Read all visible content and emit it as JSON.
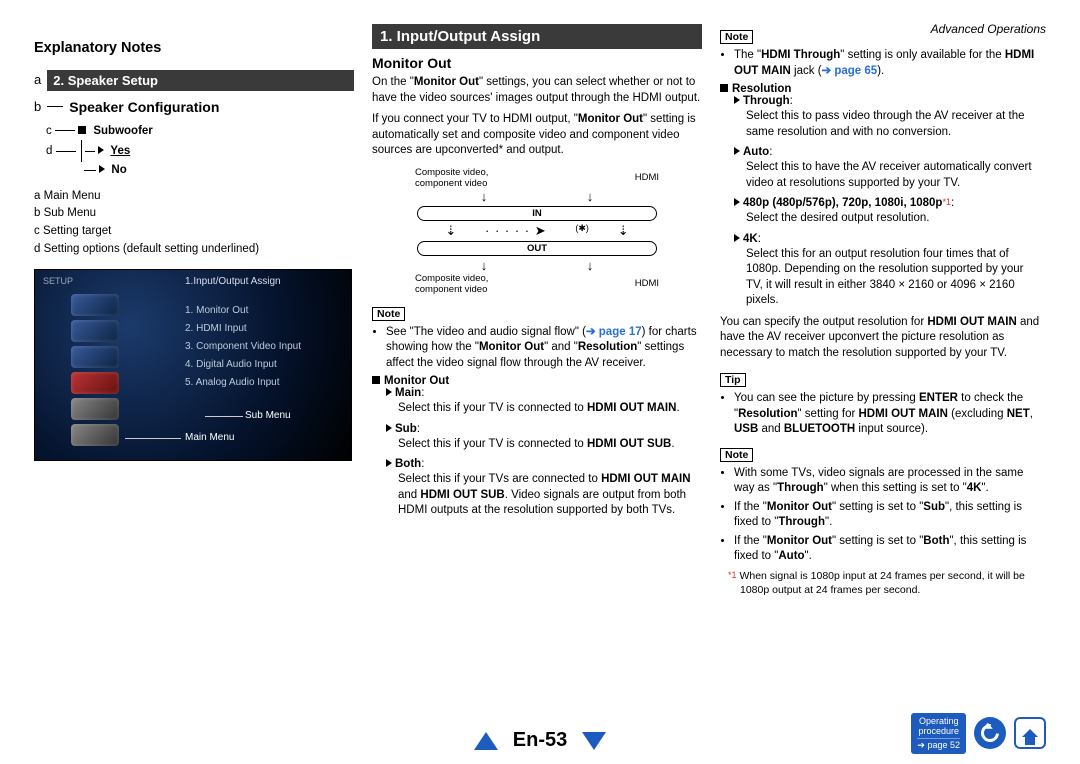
{
  "header": {
    "right": "Advanced Operations"
  },
  "col1": {
    "h": "Explanatory Notes",
    "bar": "2. Speaker Setup",
    "sub": "Speaker Configuration",
    "subwoofer_lbl": "Subwoofer",
    "yes": "Yes",
    "no": "No",
    "markers": {
      "m1": "a",
      "m2": "b",
      "m3": "c",
      "m4": "d"
    },
    "legend": {
      "l1": "Main Menu",
      "l2": "Sub Menu",
      "l3": "Setting target",
      "l4": "Setting options (default setting underlined)"
    },
    "shot": {
      "setup": "SETUP",
      "title": "1.Input/Output Assign",
      "items": [
        "1. Monitor Out",
        "2. HDMI Input",
        "3. Component Video Input",
        "4. Digital Audio Input",
        "5. Analog Audio Input"
      ],
      "ptr_sub": "Sub Menu",
      "ptr_main": "Main Menu"
    }
  },
  "col2": {
    "secTitle": "1. Input/Output Assign",
    "secSub": "Monitor Out",
    "p1a": "On the \"",
    "p1b": "Monitor Out",
    "p1c": "\" settings, you can select whether or not to have the video sources' images output through the HDMI output.",
    "p2a": "If you connect your TV to HDMI output, \"",
    "p2b": "Monitor Out",
    "p2c": "\" setting is automatically set and composite video and component video sources are upconverted* and output.",
    "sig": {
      "top_l": "Composite video,\ncomponent video",
      "top_r": "HDMI",
      "in": "IN",
      "out": "OUT",
      "star": "(✱)",
      "bot_l": "Composite video,\ncomponent video",
      "bot_r": "HDMI"
    },
    "noteLbl": "Note",
    "note1a": "See \"The video and audio signal flow\" (",
    "note1link": "➔ page 17",
    "note1b": ") for charts showing how the \"",
    "note1c": "Monitor Out",
    "note1d": "\" and \"",
    "note1e": "Resolution",
    "note1f": "\" settings affect the video signal flow through the AV receiver.",
    "mo_h": "Monitor Out",
    "main_h": "Main",
    "main_p": "Select this if your TV is connected to ",
    "main_b": "HDMI OUT MAIN",
    "sub_h": "Sub",
    "sub_p": "Select this if your TV is connected to ",
    "sub_b": "HDMI OUT SUB",
    "both_h": "Both",
    "both_p1": "Select this if your TVs are connected to ",
    "both_b1": "HDMI OUT MAIN",
    "both_mid": " and ",
    "both_b2": "HDMI OUT SUB",
    "both_p2": ". Video signals are output from both HDMI outputs at the resolution supported by both TVs."
  },
  "col3": {
    "noteLbl": "Note",
    "n1a": "The \"",
    "n1b": "HDMI Through",
    "n1c": "\" setting is only available for the ",
    "n1d": "HDMI OUT MAIN",
    "n1e": " jack (",
    "n1link": "➔ page 65",
    "n1f": ").",
    "res_h": "Resolution",
    "thr_h": "Through",
    "thr_p": "Select this to pass video through the AV receiver at the same resolution and with no conversion.",
    "auto_h": "Auto",
    "auto_p": "Select this to have the AV receiver automatically convert video at resolutions supported by your TV.",
    "reslist": "480p (480p/576p), 720p, 1080i, 1080p",
    "reslist_after": ":",
    "res_p": "Select the desired output resolution.",
    "k4_h": "4K",
    "k4_p": "Select this for an output resolution four times that of 1080p. Depending on the resolution supported by your TV, it will result in either 3840 × 2160 or 4096 × 2160 pixels.",
    "spec_p1": "You can specify the output resolution for ",
    "spec_b": "HDMI OUT MAIN",
    "spec_p2": " and have the AV receiver upconvert the picture resolution as necessary to match the resolution supported by your TV.",
    "tipLbl": "Tip",
    "tip_a": "You can see the picture by pressing ",
    "tip_b1": "ENTER",
    "tip_b": " to check the \"",
    "tip_b2": "Resolution",
    "tip_c": "\" setting for ",
    "tip_b3": "HDMI OUT MAIN",
    "tip_d": " (excluding ",
    "tip_b4": "NET",
    "tip_e": ", ",
    "tip_b5": "USB",
    "tip_f": " and ",
    "tip_b6": "BLUETOOTH",
    "tip_g": " input source).",
    "n2_1a": "With some TVs, video signals are processed in the same way as \"",
    "n2_1b": "Through",
    "n2_1c": "\" when this setting is set to \"",
    "n2_1d": "4K",
    "n2_1e": "\".",
    "n2_2a": "If the \"",
    "n2_2b": "Monitor Out",
    "n2_2c": "\" setting is set to \"",
    "n2_2d": "Sub",
    "n2_2e": "\", this setting is fixed to \"",
    "n2_2f": "Through",
    "n2_2g": "\".",
    "n2_3a": "If the \"",
    "n2_3b": "Monitor Out",
    "n2_3c": "\" setting is set to \"",
    "n2_3d": "Both",
    "n2_3e": "\", this setting is fixed to \"",
    "n2_3f": "Auto",
    "n2_3g": "\".",
    "fn_mark": "*1",
    "fn": "When signal is 1080p input at 24 frames per second, it will be 1080p output at 24 frames per second."
  },
  "footer": {
    "page": "En-53",
    "op1": "Operating",
    "op2": "procedure",
    "op3": "➔ page 52"
  }
}
